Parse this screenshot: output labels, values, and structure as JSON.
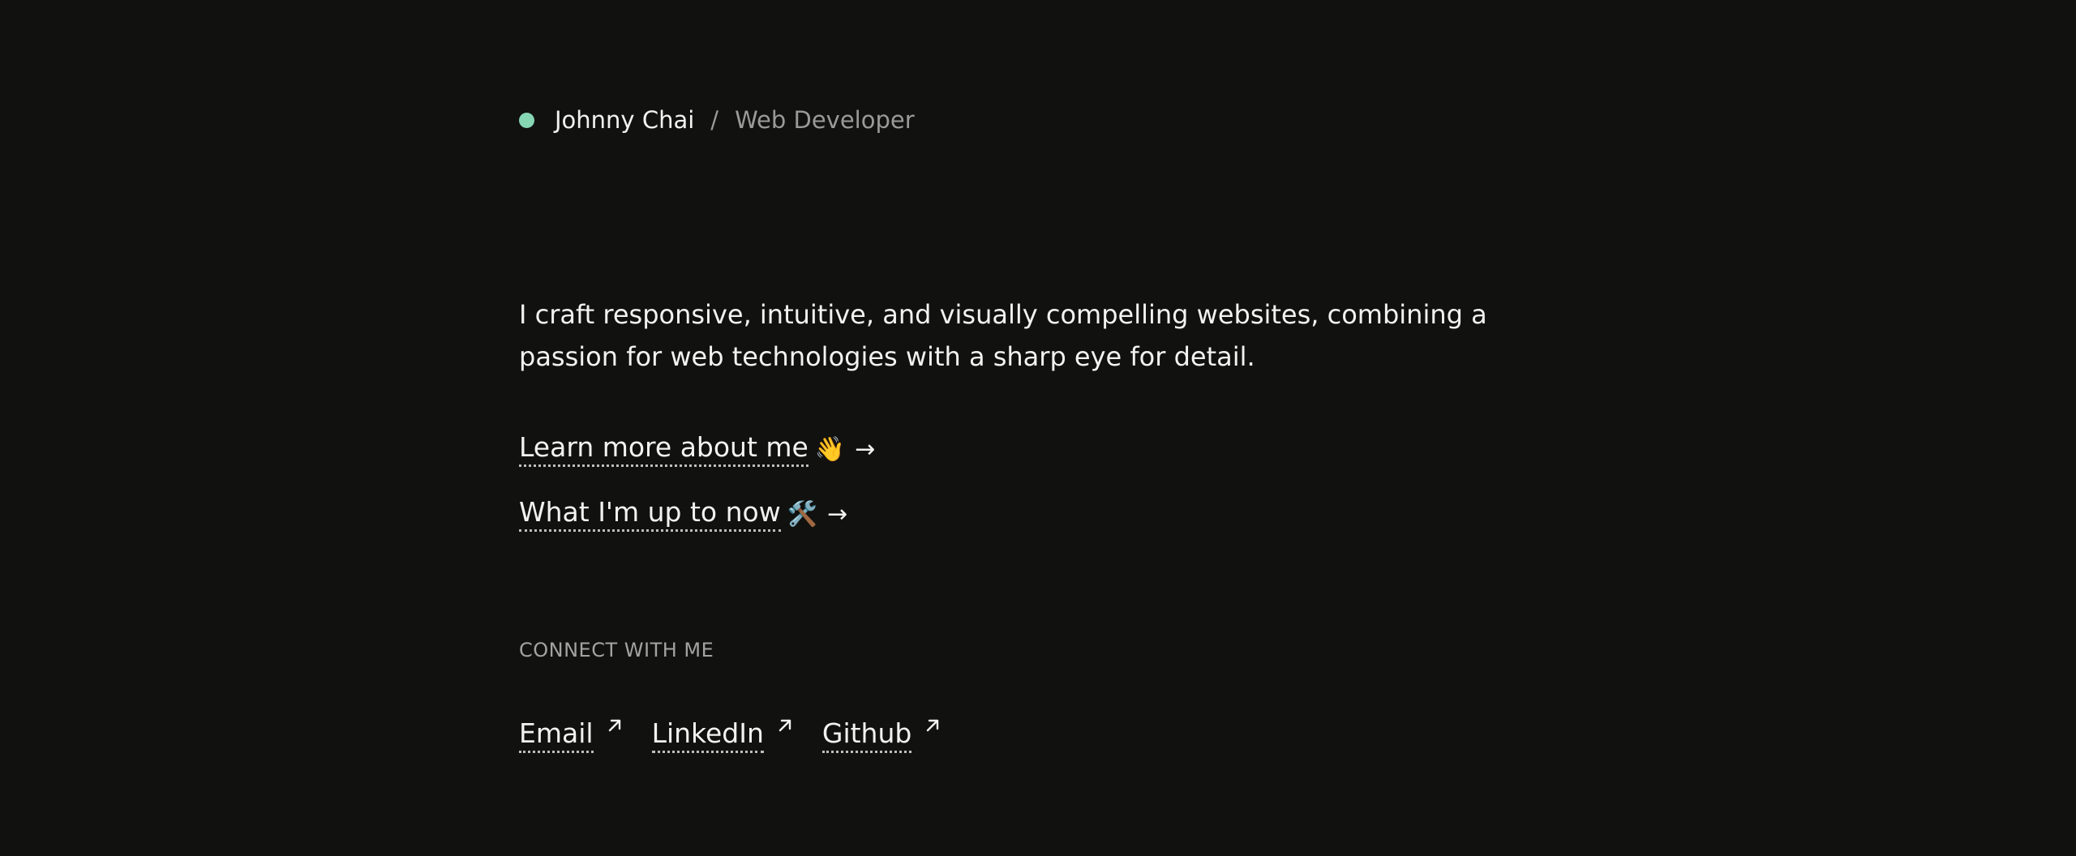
{
  "header": {
    "name": "Johnny Chai",
    "separator": "/",
    "role": "Web Developer"
  },
  "intro": {
    "text": "I craft responsive, intuitive, and visually compelling websites, combining a passion for web technologies with a sharp eye for detail."
  },
  "nav": {
    "items": [
      {
        "label": "Learn more about me",
        "emoji": "👋",
        "arrow": "→"
      },
      {
        "label": "What I'm up to now",
        "emoji": "🛠️",
        "arrow": "→"
      }
    ]
  },
  "connect": {
    "label": "CONNECT WITH ME",
    "links": [
      {
        "label": "Email"
      },
      {
        "label": "LinkedIn"
      },
      {
        "label": "Github"
      }
    ]
  },
  "colors": {
    "background": "#111110",
    "status_dot": "#86d6b4",
    "muted_text": "#9a9a98"
  }
}
